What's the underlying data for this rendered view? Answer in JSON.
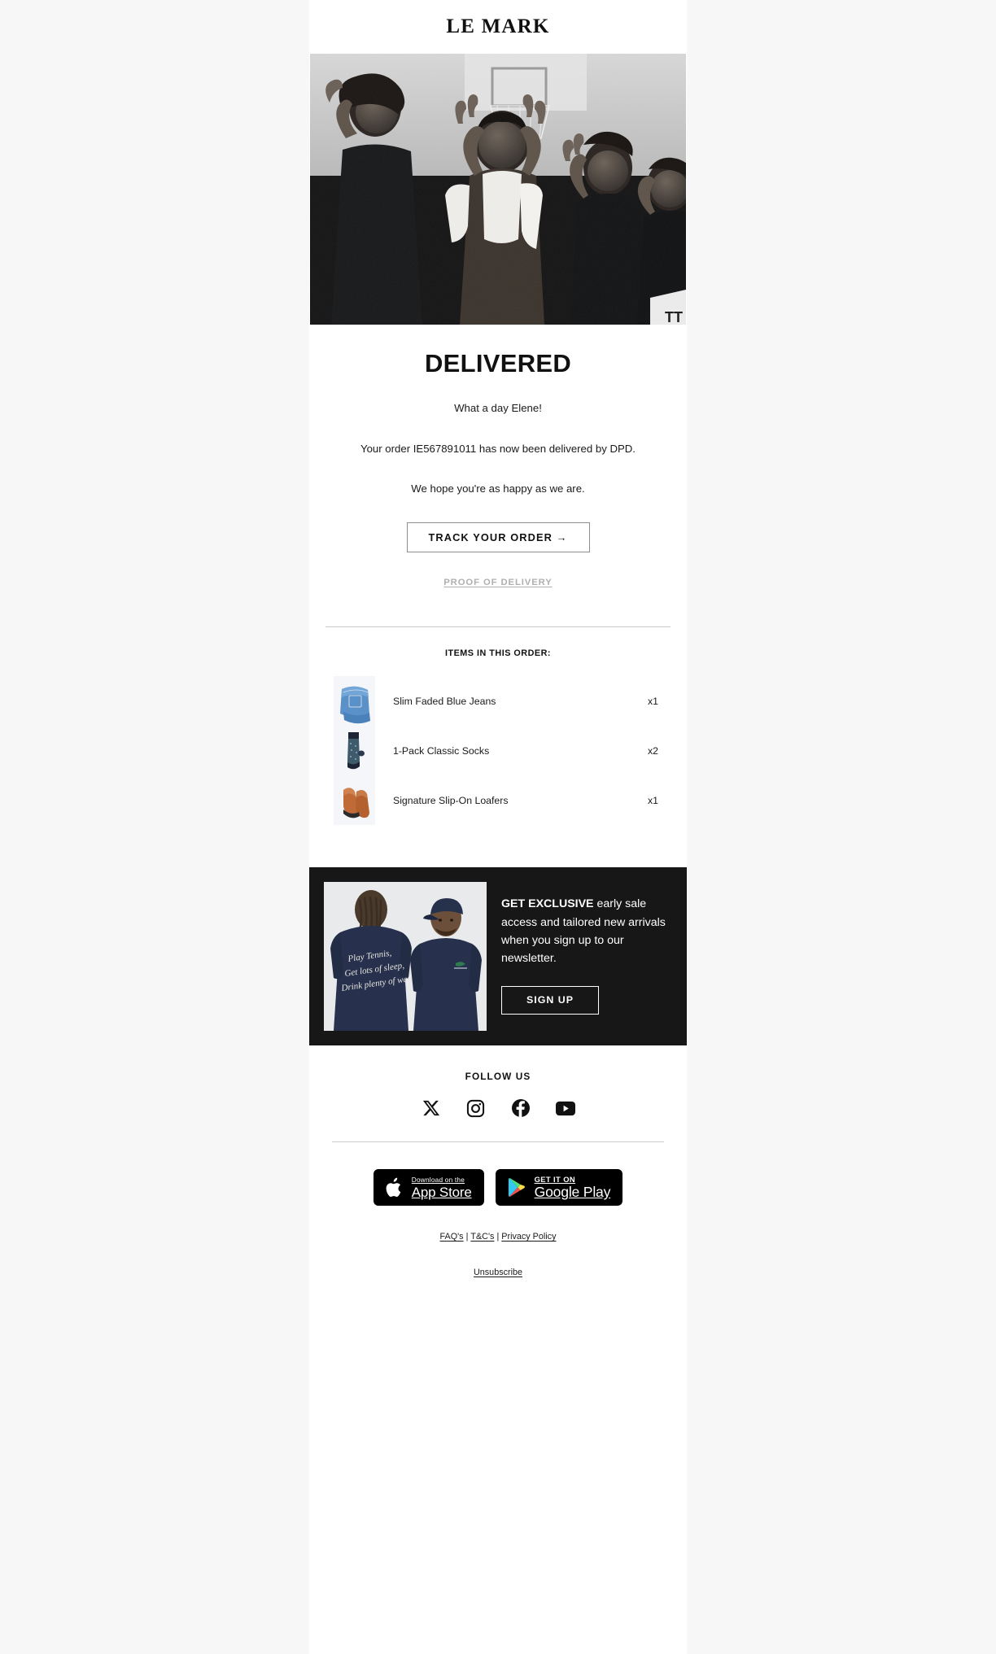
{
  "brand": {
    "logo": "LE MARK"
  },
  "hero": {
    "alt": "celebrating-group-photo"
  },
  "main": {
    "headline": "DELIVERED",
    "greeting": "What a day Elene!",
    "order_line": "Your order IE567891011 has now been delivered by DPD.",
    "order_number": "IE567891011",
    "carrier": "DPD",
    "closing": "We hope you're as happy as we are.",
    "cta_label": "TRACK YOUR ORDER →",
    "proof_link": "PROOF OF DELIVERY"
  },
  "items": {
    "title": "ITEMS IN THIS ORDER:",
    "rows": [
      {
        "name": "Slim Faded Blue Jeans",
        "qty": "x1",
        "thumb": "jeans-thumbnail"
      },
      {
        "name": "1-Pack Classic Socks",
        "qty": "x2",
        "thumb": "socks-thumbnail"
      },
      {
        "name": "Signature Slip-On Loafers",
        "qty": "x1",
        "thumb": "loafers-thumbnail"
      }
    ]
  },
  "promo": {
    "image_alt": "navy-sweatshirt-models",
    "lead": "GET EXCLUSIVE",
    "rest": " early sale access and tailored new arrivals when you sign up to our newsletter.",
    "button_label": "SIGN UP"
  },
  "follow": {
    "title": "FOLLOW US",
    "socials": [
      {
        "name": "x-twitter-icon",
        "label": "X"
      },
      {
        "name": "instagram-icon",
        "label": "Instagram"
      },
      {
        "name": "facebook-icon",
        "label": "Facebook"
      },
      {
        "name": "youtube-icon",
        "label": "YouTube"
      }
    ]
  },
  "apps": {
    "apple": {
      "small": "Download on the",
      "big": "App Store"
    },
    "google": {
      "small": "GET IT ON",
      "big": "Google Play"
    }
  },
  "legal": {
    "faq": "FAQ's",
    "terms": "T&C's",
    "privacy": "Privacy Policy",
    "sep": "|",
    "unsubscribe": "Unsubscribe"
  },
  "colors": {
    "page_bg": "#f7f7f7",
    "email_bg": "#ffffff",
    "ink": "#111111",
    "promo_bg": "#171717",
    "muted": "#b0b0b0"
  }
}
